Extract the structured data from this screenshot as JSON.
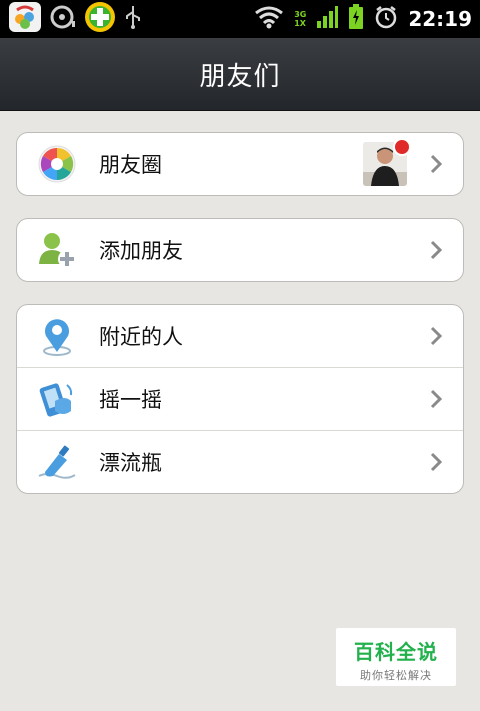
{
  "status_bar": {
    "time": "22:19",
    "network_top": "3G",
    "network_bottom": "1X",
    "icons": [
      "app-store-icon",
      "sd-card-icon",
      "add-plus-icon",
      "usb-icon",
      "wifi-icon",
      "signal-icon",
      "battery-charging-icon",
      "alarm-icon"
    ]
  },
  "header": {
    "title": "朋友们"
  },
  "groups": [
    {
      "items": [
        {
          "label": "朋友圈",
          "icon": "moments-icon",
          "has_thumbnail": true,
          "has_red_dot": true
        }
      ]
    },
    {
      "items": [
        {
          "label": "添加朋友",
          "icon": "add-friend-icon"
        }
      ]
    },
    {
      "items": [
        {
          "label": "附近的人",
          "icon": "location-pin-icon"
        },
        {
          "label": "摇一摇",
          "icon": "shake-phone-icon"
        },
        {
          "label": "漂流瓶",
          "icon": "drift-bottle-icon"
        }
      ]
    }
  ],
  "watermark": {
    "main": "百科全说",
    "sub": "助你轻松解决"
  },
  "colors": {
    "accent_green": "#22b14c",
    "title_bar": "#2d3034",
    "background": "#e8e6e2",
    "red_dot": "#e02a2a"
  }
}
